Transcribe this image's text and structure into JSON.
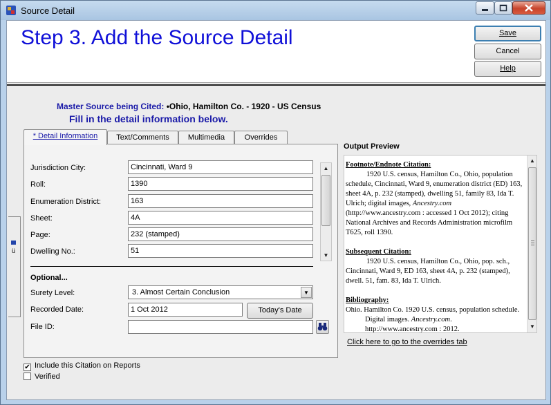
{
  "window": {
    "title": "Source Detail"
  },
  "header": {
    "step_title": "Step 3.  Add the Source Detail",
    "save_label": "Save",
    "cancel_label": "Cancel",
    "help_label": "Help"
  },
  "master_source": {
    "label": "Master Source being Cited:",
    "value": "•Ohio, Hamilton Co. - 1920 - US Census",
    "instruction": "Fill in the detail information below."
  },
  "tabs": [
    {
      "label": "* Detail Information",
      "active": true
    },
    {
      "label": "Text/Comments",
      "active": false
    },
    {
      "label": "Multimedia",
      "active": false
    },
    {
      "label": "Overrides",
      "active": false
    }
  ],
  "detail_fields": [
    {
      "label": "Jurisdiction City:",
      "value": "Cincinnati, Ward 9"
    },
    {
      "label": "Roll:",
      "value": "1390"
    },
    {
      "label": "Enumeration District:",
      "value": "163"
    },
    {
      "label": "Sheet:",
      "value": "4A"
    },
    {
      "label": "Page:",
      "value": "232 (stamped)"
    },
    {
      "label": "Dwelling No.:",
      "value": "51"
    }
  ],
  "optional": {
    "heading": "Optional...",
    "surety_label": "Surety Level:",
    "surety_value": "3.  Almost Certain Conclusion",
    "recorded_label": "Recorded Date:",
    "recorded_value": "1 Oct 2012",
    "today_label": "Today's Date",
    "file_id_label": "File ID:",
    "file_id_value": ""
  },
  "output_preview": {
    "title": "Output Preview",
    "footnote_heading": "Footnote/Endnote Citation:",
    "footnote_part1": "1920 U.S. census, Hamilton Co., Ohio, population schedule, Cincinnati, Ward 9, enumeration district (ED) 163, sheet 4A, p. 232 (stamped), dwelling 51, family 83, Ida T. Ulrich; digital images, ",
    "footnote_italic": "Ancestry.com",
    "footnote_part2": " (http://www.ancestry.com : accessed 1 Oct 2012); citing National Archives and Records Administration microfilm T625, roll 1390.",
    "subsequent_heading": "Subsequent Citation:",
    "subsequent_text": "1920 U.S. census, Hamilton Co., Ohio, pop. sch., Cincinnati, Ward 9, ED 163, sheet 4A, p. 232 (stamped), dwell. 51, fam. 83, Ida T. Ulrich.",
    "biblio_heading": "Bibliography:",
    "biblio_part1": "Ohio. Hamilton Co. 1920 U.S. census, population schedule. Digital images. ",
    "biblio_italic": "Ancestry.com",
    "biblio_part2": ". http://www.ancestry.com : 2012."
  },
  "overrides_link": "Click here to go to the overrides tab",
  "checkboxes": [
    {
      "label": "Include this Citation on Reports",
      "checked": true
    },
    {
      "label": "Verified",
      "checked": false
    }
  ],
  "icons": {
    "app": "family-tree-icon",
    "find": "binoculars-icon"
  }
}
